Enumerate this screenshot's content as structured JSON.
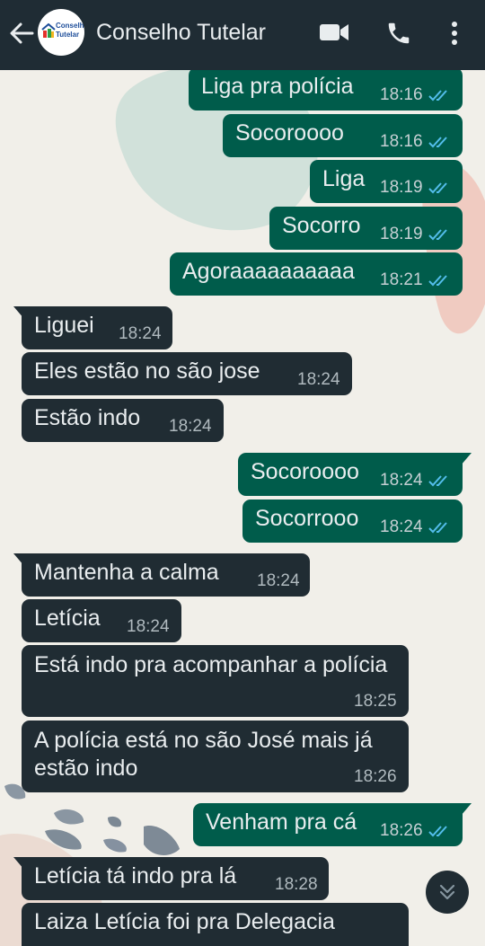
{
  "header": {
    "title": "Conselho Tutelar",
    "avatar_text": [
      "Conselho",
      "Tutelar"
    ],
    "icons": [
      "back-arrow-icon",
      "video-call-icon",
      "phone-call-icon",
      "more-options-icon"
    ]
  },
  "messages": [
    {
      "dir": "out",
      "text": "Liga pra polícia",
      "time": "18:16"
    },
    {
      "dir": "out",
      "text": "Socoroooo",
      "time": "18:16"
    },
    {
      "dir": "out",
      "text": "Liga",
      "time": "18:19"
    },
    {
      "dir": "out",
      "text": "Socorro",
      "time": "18:19"
    },
    {
      "dir": "out",
      "text": "Agoraaaaaaaaaa",
      "time": "18:21"
    },
    {
      "dir": "in",
      "text": "Liguei",
      "time": "18:24"
    },
    {
      "dir": "in",
      "text": "Eles estão no são jose",
      "time": "18:24"
    },
    {
      "dir": "in",
      "text": "Estão indo",
      "time": "18:24"
    },
    {
      "dir": "out",
      "text": "Socoroooo",
      "time": "18:24"
    },
    {
      "dir": "out",
      "text": "Socorrooo",
      "time": "18:24"
    },
    {
      "dir": "in",
      "text": "Mantenha a calma",
      "time": "18:24"
    },
    {
      "dir": "in",
      "text": "Letícia",
      "time": "18:24"
    },
    {
      "dir": "in",
      "text": "Está indo pra acompanhar a polícia",
      "time": "18:25"
    },
    {
      "dir": "in",
      "text": "A polícia está no são José mais já estão indo",
      "time": "18:26"
    },
    {
      "dir": "out",
      "text": "Venham pra cá",
      "time": "18:26"
    },
    {
      "dir": "in",
      "text": "Letícia tá indo pra lá",
      "time": "18:28"
    },
    {
      "dir": "in",
      "text": "Laiza Letícia foi pra Delegacia",
      "time": ""
    }
  ],
  "colors": {
    "header": "#1f2c34",
    "outgoing_bubble": "#005c4b",
    "incoming_bubble": "#202c33",
    "read_ticks": "#53bdeb"
  }
}
